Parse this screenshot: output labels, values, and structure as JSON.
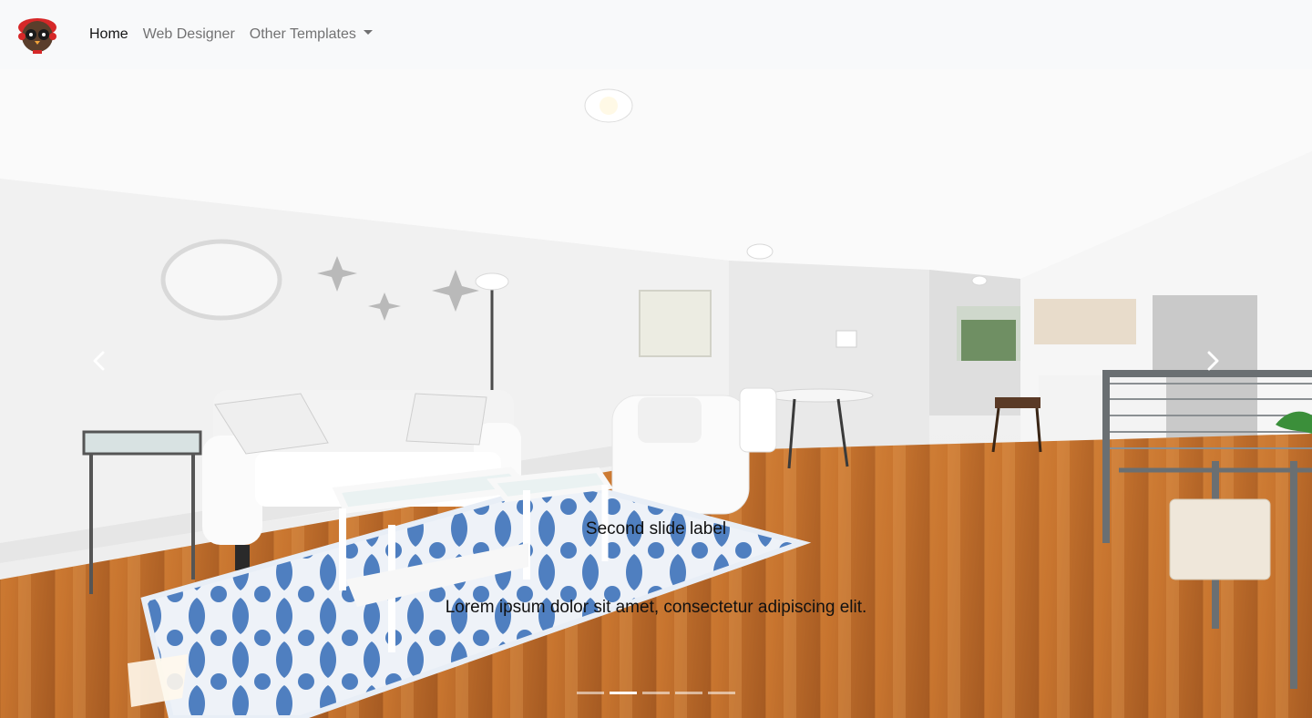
{
  "navbar": {
    "brand_icon": "owl-mascot-logo",
    "links": [
      {
        "label": "Home",
        "active": true
      },
      {
        "label": "Web Designer",
        "active": false
      },
      {
        "label": "Other Templates",
        "active": false,
        "dropdown": true
      }
    ]
  },
  "carousel": {
    "caption_title": "Second slide label",
    "caption_text": "Lorem ipsum dolor sit amet, consectetur adipiscing elit.",
    "prev_icon": "chevron-left-icon",
    "next_icon": "chevron-right-icon",
    "indicator_count": 5,
    "active_index": 1
  },
  "colors": {
    "navbar_bg": "#f8f9fa",
    "floor": "#c8752f",
    "rug": "#4f7fc0"
  }
}
